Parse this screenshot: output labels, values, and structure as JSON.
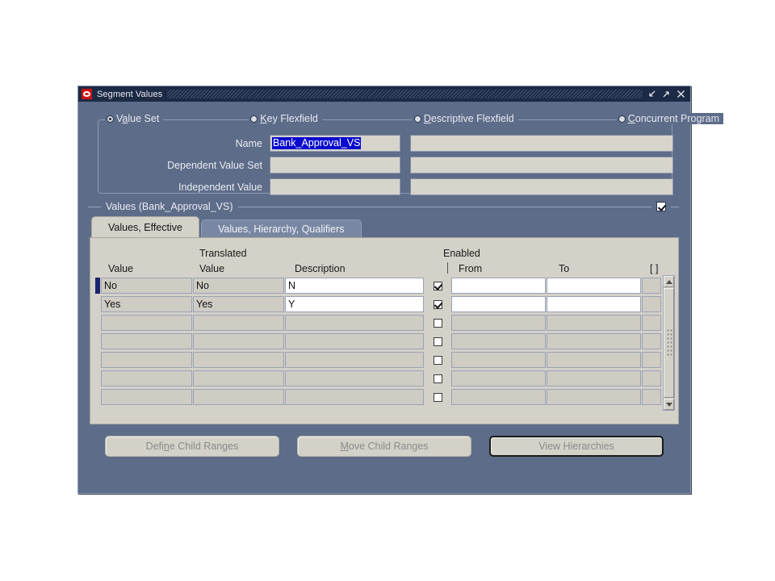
{
  "window": {
    "title": "Segment Values",
    "logo_icon": "oracle-logo-icon",
    "controls": [
      {
        "name": "minimize-button",
        "glyph": "minimize-icon"
      },
      {
        "name": "maximize-button",
        "glyph": "maximize-icon"
      },
      {
        "name": "close-button",
        "glyph": "close-icon"
      }
    ]
  },
  "colors": {
    "window_background": "#5d6c88",
    "titlebar": "#1d2a45",
    "oracle_red": "#cc1111",
    "panel": "#d4d1c9",
    "field": "#d7d4cc",
    "selection_blue": "#0909cf",
    "record_indicator": "#1b246e"
  },
  "radios": [
    {
      "label_before": "V",
      "mnemonic": "a",
      "label_after": "lue Set",
      "selected": true
    },
    {
      "label_before": "",
      "mnemonic": "K",
      "label_after": "ey Flexfield",
      "selected": false
    },
    {
      "label_before": "",
      "mnemonic": "D",
      "label_after": "escriptive Flexfield",
      "selected": false
    },
    {
      "label_before": "",
      "mnemonic": "C",
      "label_after": "oncurrent Program",
      "selected": false
    }
  ],
  "fields": {
    "name": {
      "label": "Name",
      "value": "Bank_Approval_VS",
      "selected": true,
      "right_value": "",
      "placeholder": ""
    },
    "dependent_value_set": {
      "label": "Dependent Value Set",
      "value": "",
      "right_value": "",
      "placeholder": ""
    },
    "independent_value": {
      "label": "Independent Value",
      "value": "",
      "right_value": "",
      "placeholder": ""
    }
  },
  "values_group": {
    "title": "Values (Bank_Approval_VS)",
    "checkbox_checked": true
  },
  "tabs": [
    {
      "label": "Values, Effective",
      "active": true
    },
    {
      "label": "Values, Hierarchy, Qualifiers",
      "active": false
    }
  ],
  "grid": {
    "headers": {
      "value": "Value",
      "translated_line1": "Translated",
      "translated_line2": "Value",
      "description": "Description",
      "enabled": "Enabled",
      "from": "From",
      "to": "To",
      "brackets": "[ ]"
    },
    "rows": [
      {
        "value": "No",
        "translated": "No",
        "description": "N",
        "enabled": true,
        "from": "",
        "to": "",
        "brackets": "",
        "current": true
      },
      {
        "value": "Yes",
        "translated": "Yes",
        "description": "Y",
        "enabled": true,
        "from": "",
        "to": "",
        "brackets": "",
        "current": false
      },
      {
        "value": "",
        "translated": "",
        "description": "",
        "enabled": false,
        "from": "",
        "to": "",
        "brackets": "",
        "current": false
      },
      {
        "value": "",
        "translated": "",
        "description": "",
        "enabled": false,
        "from": "",
        "to": "",
        "brackets": "",
        "current": false
      },
      {
        "value": "",
        "translated": "",
        "description": "",
        "enabled": false,
        "from": "",
        "to": "",
        "brackets": "",
        "current": false
      },
      {
        "value": "",
        "translated": "",
        "description": "",
        "enabled": false,
        "from": "",
        "to": "",
        "brackets": "",
        "current": false
      },
      {
        "value": "",
        "translated": "",
        "description": "",
        "enabled": false,
        "from": "",
        "to": "",
        "brackets": "",
        "current": false
      }
    ]
  },
  "buttons": [
    {
      "before": "Defi",
      "mnemonic": "n",
      "after": "e Child Ranges",
      "disabled": true,
      "focused": false
    },
    {
      "before": "",
      "mnemonic": "M",
      "after": "ove Child Ranges",
      "disabled": true,
      "focused": false
    },
    {
      "before": "View Hierarchies",
      "mnemonic": "",
      "after": "",
      "disabled": true,
      "focused": true
    }
  ]
}
